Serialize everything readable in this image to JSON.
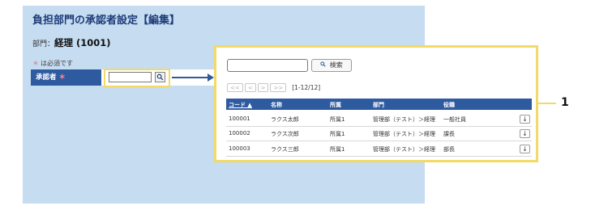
{
  "page": {
    "title": "負担部門の承認者設定【編集】",
    "dept_label": "部門：",
    "dept_value": "経理 (1001)",
    "required_star": "＊",
    "required_note": "は必須です"
  },
  "form": {
    "approver_label": "承認者",
    "required_star": "＊",
    "search_icon": "search-icon"
  },
  "popup": {
    "search_button_label": "検索",
    "search_icon": "magnifier-icon",
    "pager": {
      "first": "<<",
      "prev": "<",
      "next": ">",
      "last": ">>",
      "info": "[1-12/12]"
    },
    "columns": [
      "コード ▲",
      "名称",
      "所属",
      "部門",
      "役職"
    ],
    "rows": [
      {
        "code": "100001",
        "name": "ラクス太郎",
        "affiliation": "所属1",
        "dept": "管理部（テスト）＞経理",
        "title": "一般社員"
      },
      {
        "code": "100002",
        "name": "ラクス次郎",
        "affiliation": "所属1",
        "dept": "管理部（テスト）＞経理",
        "title": "課長"
      },
      {
        "code": "100003",
        "name": "ラクス三郎",
        "affiliation": "所属1",
        "dept": "管理部（テスト）＞経理",
        "title": "部長"
      }
    ],
    "row_action_icon": "arrow-down-icon"
  },
  "callout": {
    "number": "1"
  },
  "colors": {
    "panel_bg": "#c5dcf1",
    "header_blue": "#2e5aa0",
    "title_blue": "#1e3c78",
    "highlight_yellow": "#f3da66",
    "required_red": "#e46b6b"
  }
}
